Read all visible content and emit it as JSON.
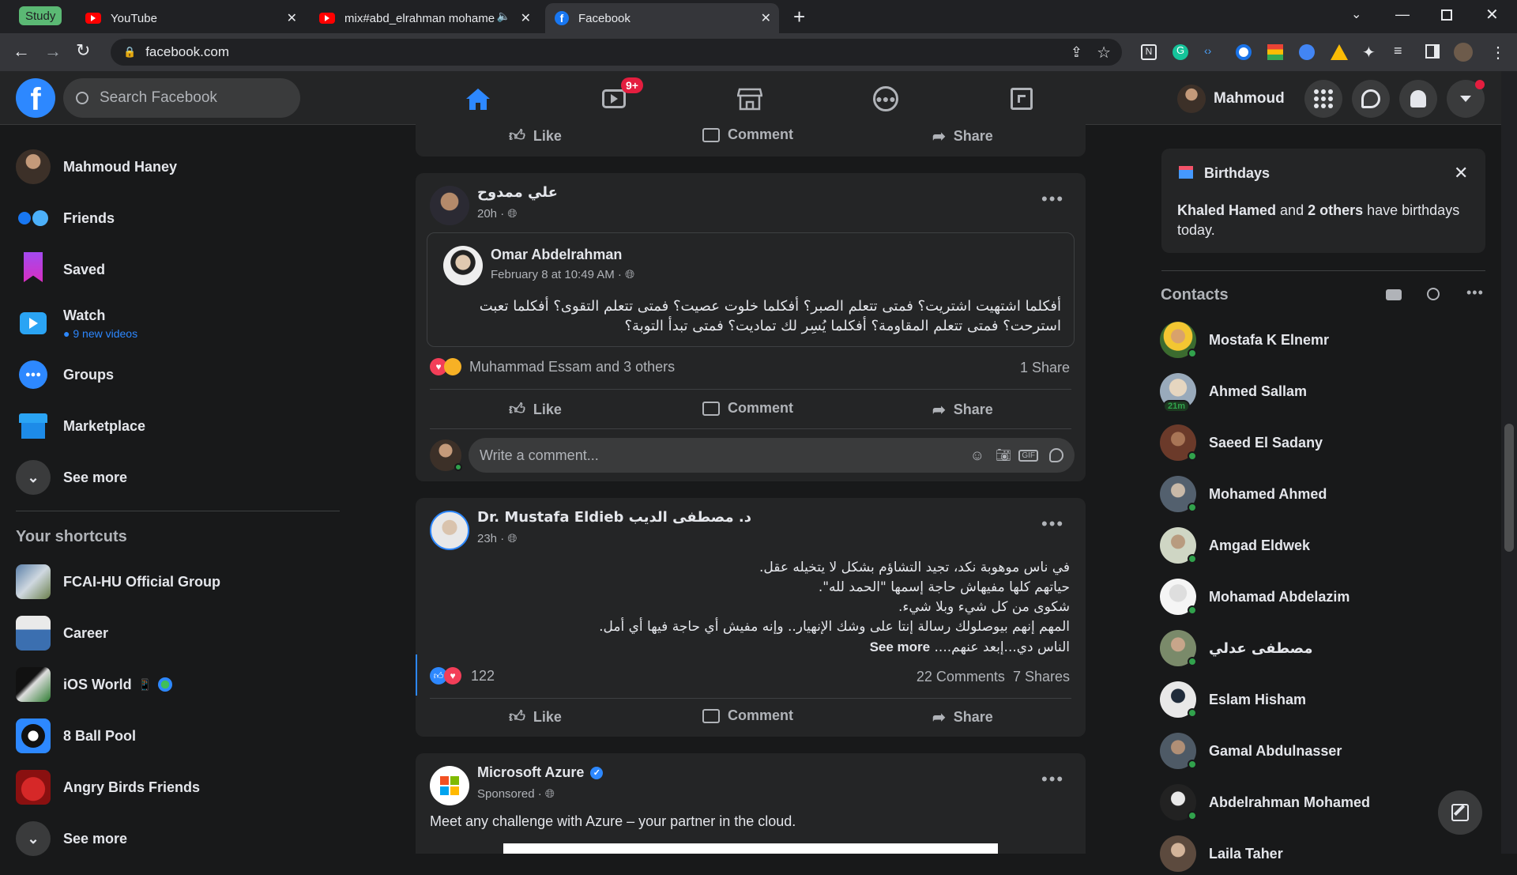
{
  "browser": {
    "tabs": [
      {
        "label": "YouTube"
      },
      {
        "label": "mix#abd_elrahman mohame"
      },
      {
        "label": "Facebook"
      }
    ],
    "group_label": "Study",
    "url": "facebook.com"
  },
  "header": {
    "search_placeholder": "Search Facebook",
    "watch_badge": "9+",
    "profile_name": "Mahmoud"
  },
  "left_nav": {
    "items": [
      {
        "label": "Mahmoud Haney"
      },
      {
        "label": "Friends"
      },
      {
        "label": "Saved"
      },
      {
        "label": "Watch",
        "sub": "9 new videos"
      },
      {
        "label": "Groups"
      },
      {
        "label": "Marketplace"
      },
      {
        "label": "See more"
      }
    ],
    "shortcuts_title": "Your shortcuts",
    "shortcuts": [
      {
        "label": "FCAI-HU Official Group"
      },
      {
        "label": "Career"
      },
      {
        "label": "iOS World"
      },
      {
        "label": "8 Ball Pool"
      },
      {
        "label": "Angry Birds Friends"
      },
      {
        "label": "See more"
      }
    ]
  },
  "actions": {
    "like": "Like",
    "comment": "Comment",
    "share": "Share"
  },
  "posts": {
    "p1": {
      "author": "علي ممدوح",
      "time": "20h ·",
      "shared_author": "Omar Abdelrahman",
      "shared_time": "February 8 at 10:49 AM ·",
      "text": "أفكلما اشتهيت اشتريت؟  فمتى تتعلم الصبر؟  أفكلما خلوت عصيت؟  فمتى تتعلم التقوى؟  أفكلما تعبت استرحت؟ فمتى تتعلم المقاومة؟ أفكلما يُسِر لك تماديت؟ فمتى تبدأ التوبة؟",
      "reactions": "Muhammad Essam and 3 others",
      "shares": "1 Share",
      "comment_placeholder": "Write a comment..."
    },
    "p2": {
      "author": "Dr. Mustafa Eldieb د. مصطفى الديب",
      "time": "23h ·",
      "lines": [
        "في ناس موهوبة نكد، تجيد التشاؤم بشكل لا يتخيله عقل.",
        "حياتهم كلها مفيهاش حاجة إسمها \"الحمد لله\".",
        "شكوى من كل شيء وبلا شيء.",
        "المهم إنهم بيوصلولك رسالة إنتا على وشك الإنهيار.. وإنه مفيش أي حاجة فيها أي أمل.",
        "الناس دي...إبعد عنهم...."
      ],
      "see_more": "See more",
      "reaction_count": "122",
      "comments": "22 Comments",
      "shares": "7 Shares"
    },
    "p3": {
      "author": "Microsoft Azure",
      "time": "Sponsored ·",
      "text": "Meet any challenge with Azure – your partner in the cloud."
    }
  },
  "birthdays": {
    "title": "Birthdays",
    "name": "Khaled Hamed",
    "mid": " and ",
    "others": "2 others",
    "rest": " have birthdays today."
  },
  "contacts": {
    "title": "Contacts",
    "list": [
      {
        "name": "Mostafa K Elnemr"
      },
      {
        "name": "Ahmed Sallam",
        "badge": "21m"
      },
      {
        "name": "Saeed El Sadany"
      },
      {
        "name": "Mohamed Ahmed"
      },
      {
        "name": "Amgad Eldwek"
      },
      {
        "name": "Mohamad Abdelazim"
      },
      {
        "name": "مصطفى عدلي"
      },
      {
        "name": "Eslam Hisham"
      },
      {
        "name": "Gamal Abdulnasser"
      },
      {
        "name": "Abdelrahman Mohamed"
      },
      {
        "name": "Laila Taher"
      }
    ]
  },
  "colors": {
    "fb_blue": "#2d88ff",
    "bg": "#18191a",
    "card": "#242526",
    "online": "#31a24c",
    "badge_red": "#e41e3f"
  }
}
